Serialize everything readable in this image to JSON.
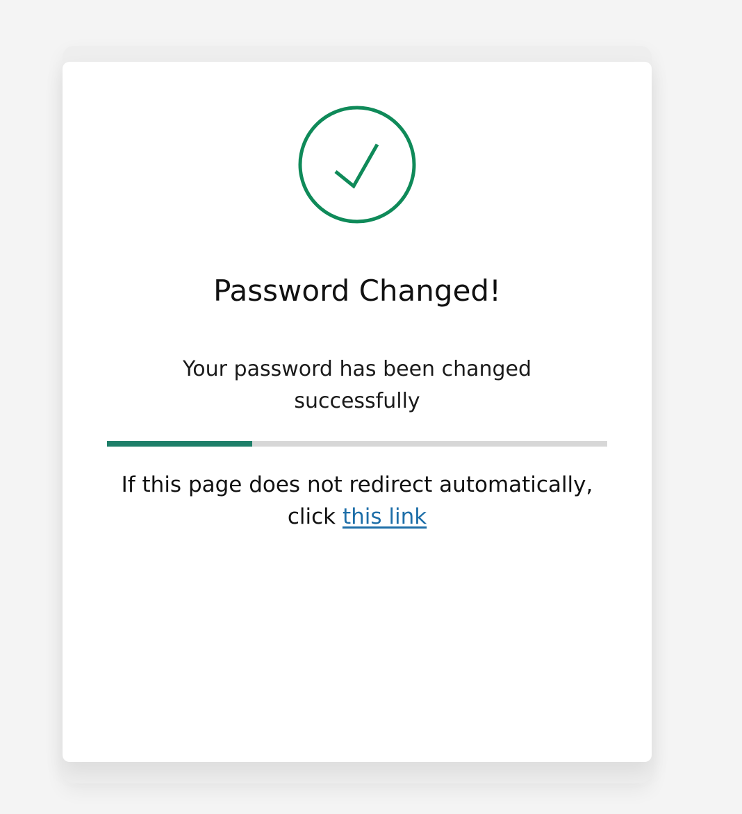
{
  "status": {
    "icon": "check-circle-icon",
    "title": "Password Changed!",
    "message": "Your password has been changed successfully",
    "progress": 0.29
  },
  "redirect": {
    "text_prefix": "If this page does not redirect automatically, click",
    "link_label": "this link"
  },
  "colors": {
    "page_background": "#f4f4f4",
    "card_background": "#ffffff",
    "success_green": "#0f8a59",
    "progress_fill": "#1e7f69",
    "progress_track": "#d7d7d7",
    "link_blue": "#1d6ea8"
  }
}
